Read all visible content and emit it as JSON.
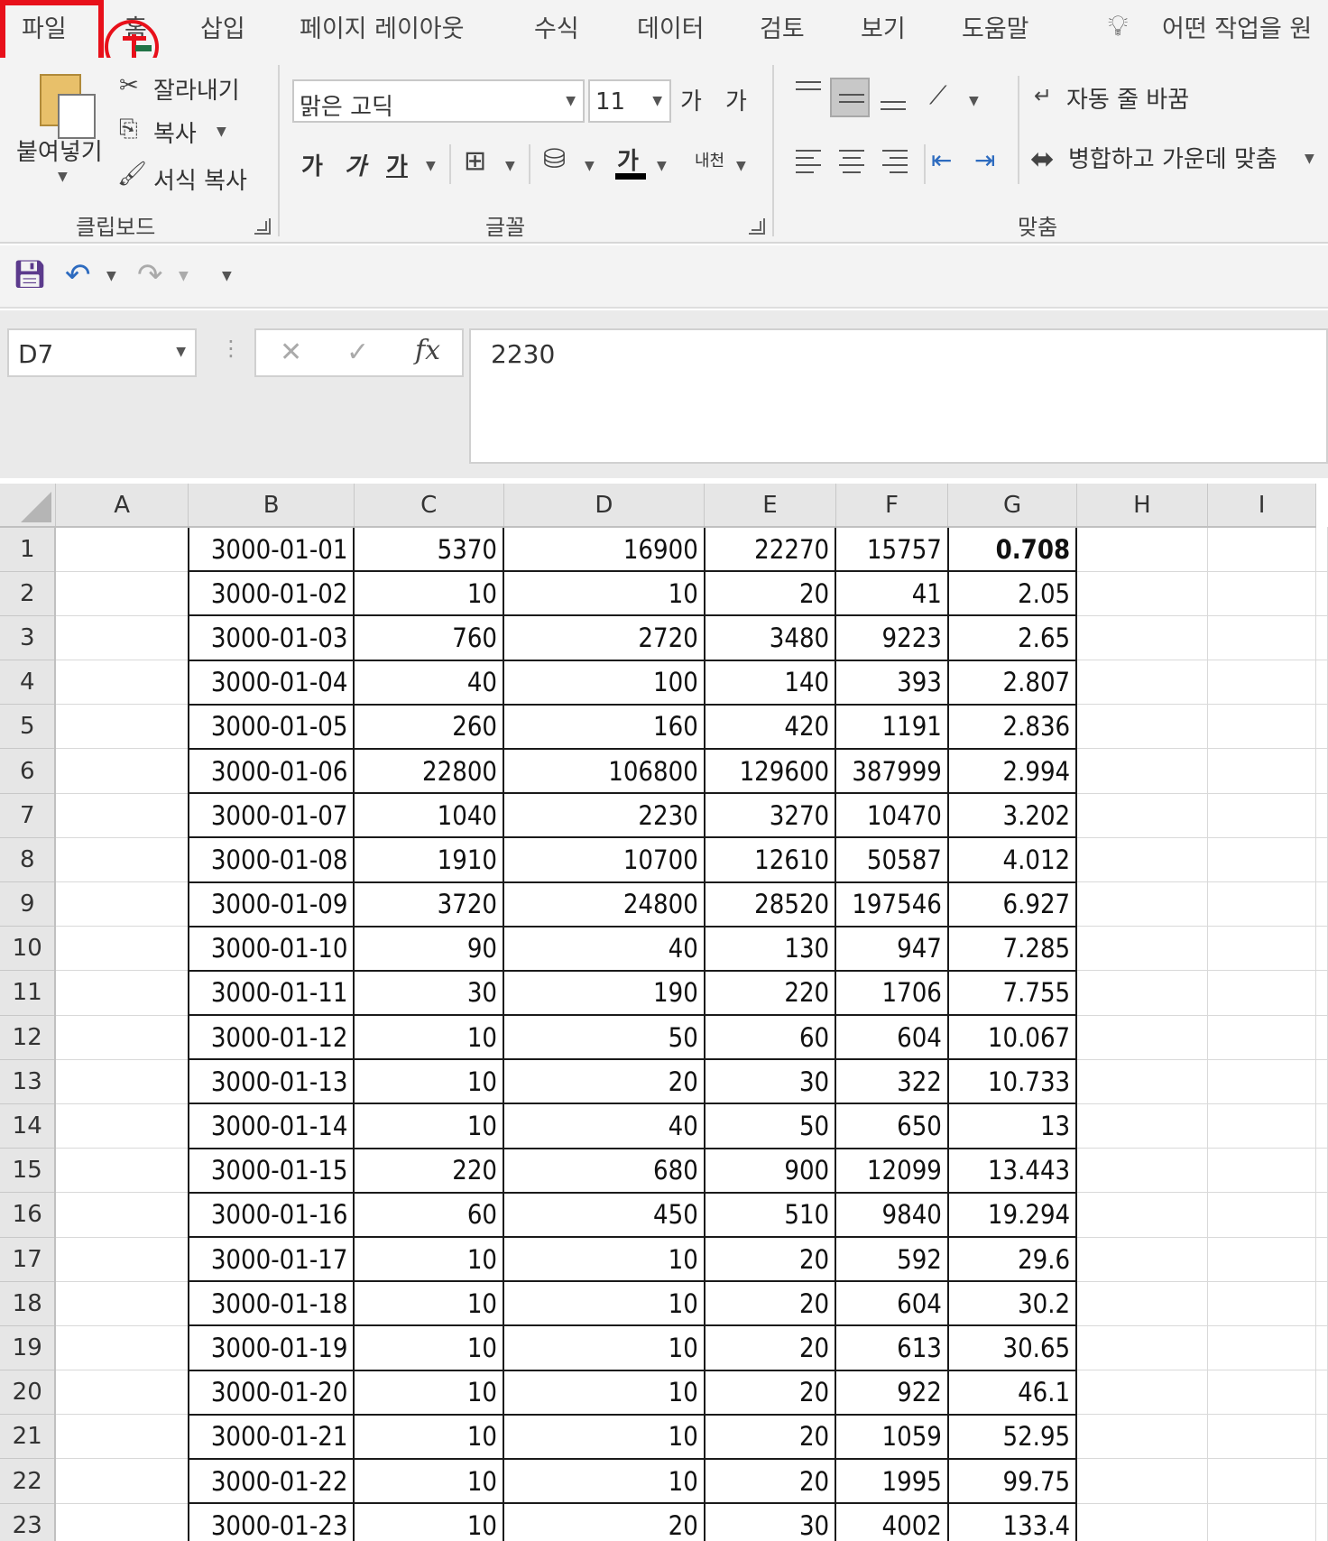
{
  "menu": {
    "tabs": [
      "파일",
      "홈",
      "삽입",
      "페이지 레이아웃",
      "수식",
      "데이터",
      "검토",
      "보기",
      "도움말"
    ],
    "tell_me": "어떤 작업을 원"
  },
  "ribbon": {
    "clipboard": {
      "paste": "붙여넣기",
      "cut": "잘라내기",
      "copy": "복사",
      "format_painter": "서식 복사",
      "label": "클립보드"
    },
    "font": {
      "name": "맑은 고딕",
      "size": "11",
      "grow": "가",
      "shrink": "가",
      "bold": "가",
      "italic": "가",
      "underline": "가",
      "font_color_glyph": "가",
      "phonetic": "내천",
      "label": "글꼴"
    },
    "alignment": {
      "wrap_text": "자동 줄 바꿈",
      "merge_center": "병합하고 가운데 맞춤",
      "label": "맞춤"
    }
  },
  "formula_bar": {
    "name_box": "D7",
    "fx": "fx",
    "value": "2230"
  },
  "sheet": {
    "columns": [
      "A",
      "B",
      "C",
      "D",
      "E",
      "F",
      "G",
      "H",
      "I"
    ],
    "rows": [
      {
        "n": "1",
        "b": "3000-01-01",
        "c": "5370",
        "d": "16900",
        "e": "22270",
        "f": "15757",
        "g": "0.708"
      },
      {
        "n": "2",
        "b": "3000-01-02",
        "c": "10",
        "d": "10",
        "e": "20",
        "f": "41",
        "g": "2.05"
      },
      {
        "n": "3",
        "b": "3000-01-03",
        "c": "760",
        "d": "2720",
        "e": "3480",
        "f": "9223",
        "g": "2.65"
      },
      {
        "n": "4",
        "b": "3000-01-04",
        "c": "40",
        "d": "100",
        "e": "140",
        "f": "393",
        "g": "2.807"
      },
      {
        "n": "5",
        "b": "3000-01-05",
        "c": "260",
        "d": "160",
        "e": "420",
        "f": "1191",
        "g": "2.836"
      },
      {
        "n": "6",
        "b": "3000-01-06",
        "c": "22800",
        "d": "106800",
        "e": "129600",
        "f": "387999",
        "g": "2.994"
      },
      {
        "n": "7",
        "b": "3000-01-07",
        "c": "1040",
        "d": "2230",
        "e": "3270",
        "f": "10470",
        "g": "3.202"
      },
      {
        "n": "8",
        "b": "3000-01-08",
        "c": "1910",
        "d": "10700",
        "e": "12610",
        "f": "50587",
        "g": "4.012"
      },
      {
        "n": "9",
        "b": "3000-01-09",
        "c": "3720",
        "d": "24800",
        "e": "28520",
        "f": "197546",
        "g": "6.927"
      },
      {
        "n": "10",
        "b": "3000-01-10",
        "c": "90",
        "d": "40",
        "e": "130",
        "f": "947",
        "g": "7.285"
      },
      {
        "n": "11",
        "b": "3000-01-11",
        "c": "30",
        "d": "190",
        "e": "220",
        "f": "1706",
        "g": "7.755"
      },
      {
        "n": "12",
        "b": "3000-01-12",
        "c": "10",
        "d": "50",
        "e": "60",
        "f": "604",
        "g": "10.067"
      },
      {
        "n": "13",
        "b": "3000-01-13",
        "c": "10",
        "d": "20",
        "e": "30",
        "f": "322",
        "g": "10.733"
      },
      {
        "n": "14",
        "b": "3000-01-14",
        "c": "10",
        "d": "40",
        "e": "50",
        "f": "650",
        "g": "13"
      },
      {
        "n": "15",
        "b": "3000-01-15",
        "c": "220",
        "d": "680",
        "e": "900",
        "f": "12099",
        "g": "13.443"
      },
      {
        "n": "16",
        "b": "3000-01-16",
        "c": "60",
        "d": "450",
        "e": "510",
        "f": "9840",
        "g": "19.294"
      },
      {
        "n": "17",
        "b": "3000-01-17",
        "c": "10",
        "d": "10",
        "e": "20",
        "f": "592",
        "g": "29.6"
      },
      {
        "n": "18",
        "b": "3000-01-18",
        "c": "10",
        "d": "10",
        "e": "20",
        "f": "604",
        "g": "30.2"
      },
      {
        "n": "19",
        "b": "3000-01-19",
        "c": "10",
        "d": "10",
        "e": "20",
        "f": "613",
        "g": "30.65"
      },
      {
        "n": "20",
        "b": "3000-01-20",
        "c": "10",
        "d": "10",
        "e": "20",
        "f": "922",
        "g": "46.1"
      },
      {
        "n": "21",
        "b": "3000-01-21",
        "c": "10",
        "d": "10",
        "e": "20",
        "f": "1059",
        "g": "52.95"
      },
      {
        "n": "22",
        "b": "3000-01-22",
        "c": "10",
        "d": "10",
        "e": "20",
        "f": "1995",
        "g": "99.75"
      },
      {
        "n": "23",
        "b": "3000-01-23",
        "c": "10",
        "d": "20",
        "e": "30",
        "f": "4002",
        "g": "133.4"
      }
    ]
  },
  "colors": {
    "highlight": "#e8101a",
    "excel_green": "#217346",
    "save_icon": "#5b3a8c",
    "undo_icon": "#2d6bbf"
  }
}
